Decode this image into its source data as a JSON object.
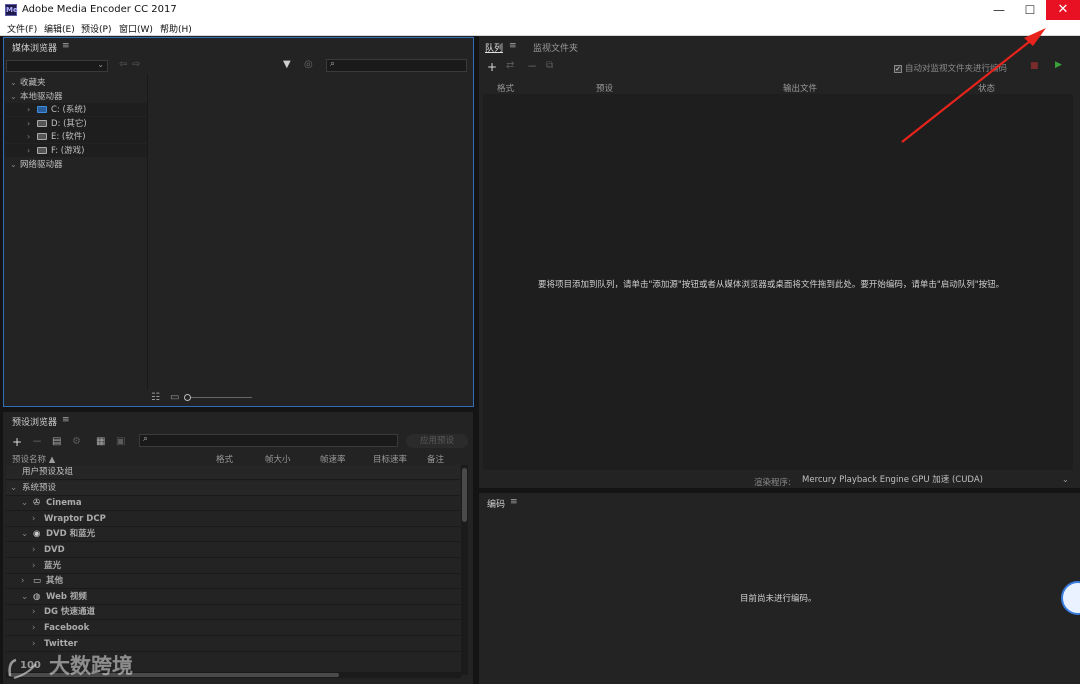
{
  "window": {
    "title": "Adobe Media Encoder CC 2017",
    "app_icon": "Me",
    "controls": {
      "minimize": "—",
      "maximize": "☐",
      "close": "✕"
    }
  },
  "menu": [
    "文件(F)",
    "编辑(E)",
    "预设(P)",
    "窗口(W)",
    "帮助(H)"
  ],
  "media_browser": {
    "title": "媒体浏览器",
    "menu_icon": "≡",
    "tree": {
      "favorites": "收藏夹",
      "local_drives": "本地驱动器",
      "drives": [
        "C: (系统)",
        "D: (其它)",
        "E: (软件)",
        "F: (游戏)"
      ],
      "network_drives": "网络驱动器"
    }
  },
  "queue": {
    "tabs": [
      "队列",
      "监视文件夹"
    ],
    "menu_icon": "≡",
    "auto_encode_label": "自动对监视文件夹进行编码",
    "columns": [
      "格式",
      "预设",
      "输出文件",
      "状态"
    ],
    "empty_message": "要将项目添加到队列，请单击\"添加源\"按钮或者从媒体浏览器或桌面将文件拖到此处。要开始编码，请单击\"启动队列\"按钮。",
    "renderer_label": "渲染程序:",
    "renderer_value": "Mercury Playback Engine GPU 加速 (CUDA)"
  },
  "preset_browser": {
    "title": "预设浏览器",
    "menu_icon": "≡",
    "apply_button": "应用预设",
    "columns": [
      "预设名称 ▲",
      "格式",
      "帧大小",
      "帧速率",
      "目标速率",
      "备注"
    ],
    "rows": [
      {
        "label": "用户预设及组",
        "arrow": "",
        "level": 0,
        "group": true
      },
      {
        "label": "系统预设",
        "arrow": "⌄",
        "level": 0,
        "group": true
      },
      {
        "label": "Cinema",
        "arrow": "⌄",
        "level": 1,
        "icon": "film-icon"
      },
      {
        "label": "Wraptor DCP",
        "arrow": "›",
        "level": 2
      },
      {
        "label": "DVD 和蓝光",
        "arrow": "⌄",
        "level": 1,
        "icon": "disc-icon"
      },
      {
        "label": "DVD",
        "arrow": "›",
        "level": 2
      },
      {
        "label": "蓝光",
        "arrow": "›",
        "level": 2
      },
      {
        "label": "其他",
        "arrow": "›",
        "level": 1,
        "icon": "monitor-icon"
      },
      {
        "label": "Web 视频",
        "arrow": "⌄",
        "level": 1,
        "icon": "globe-icon"
      },
      {
        "label": "DG 快速通道",
        "arrow": "›",
        "level": 2
      },
      {
        "label": "Facebook",
        "arrow": "›",
        "level": 2
      },
      {
        "label": "Twitter",
        "arrow": "›",
        "level": 2
      }
    ]
  },
  "encoding": {
    "title": "编码",
    "menu_icon": "≡",
    "idle_message": "目前尚未进行编码。"
  },
  "watermark": {
    "text": "大数跨境",
    "logo_text": "100"
  },
  "colors": {
    "accent_blue": "#2f6db5",
    "close_red": "#e81123",
    "annotation_red": "#e8231b",
    "start_green": "#3aa33a"
  }
}
